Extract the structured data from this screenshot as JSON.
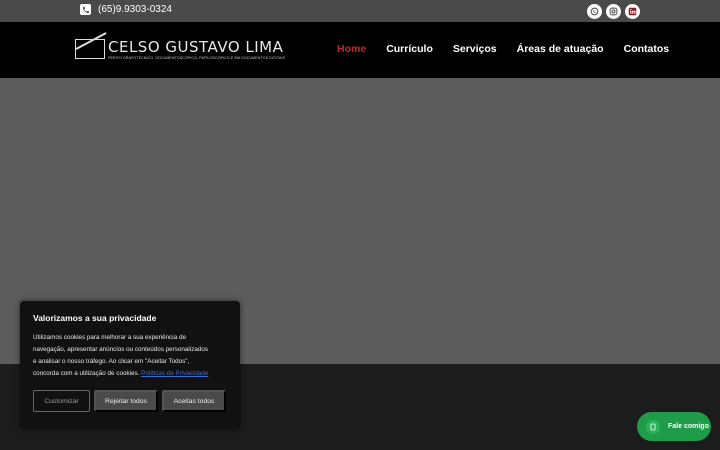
{
  "topbar": {
    "phone": "(65)9.9303-0324",
    "social": [
      {
        "icon": "whatsapp-icon",
        "color": "#25d366"
      },
      {
        "icon": "instagram-icon",
        "color": "#c13584"
      },
      {
        "icon": "linkedin-icon",
        "color": "#8b1c23"
      }
    ]
  },
  "logo": {
    "name": "CELSO GUSTAVO LIMA",
    "subtitle": "PERITO GRAFOTÉCNICO, DOCUMENTOSCÓPICO, PAPILOSCÓPICO E EM DOCUMENTOS DIGITAIS"
  },
  "nav": {
    "items": [
      {
        "label": "Home",
        "active": true
      },
      {
        "label": "Currículo",
        "active": false
      },
      {
        "label": "Serviços",
        "active": false
      },
      {
        "label": "Áreas de atuação",
        "active": false
      },
      {
        "label": "Contatos",
        "active": false
      }
    ]
  },
  "cookie": {
    "title": "Valorizamos a sua privacidade",
    "text": "Utilizamos cookies para melhorar a sua experiência de navegação, apresentar anúncios ou conteúdos personalizados e analisar o nosso tráfego. Ao clicar em \"Aceitar Todos\", concorda com a utilização de cookies.",
    "link": "Políticas de Privacidade",
    "customize": "Customizar",
    "reject": "Rejeitar todos",
    "accept": "Aceitas todos"
  },
  "chat": {
    "label": "Fale comigo"
  },
  "colors": {
    "accent": "#c0272d",
    "chat": "#1e9c4a",
    "hero": "#5c5c5c"
  }
}
